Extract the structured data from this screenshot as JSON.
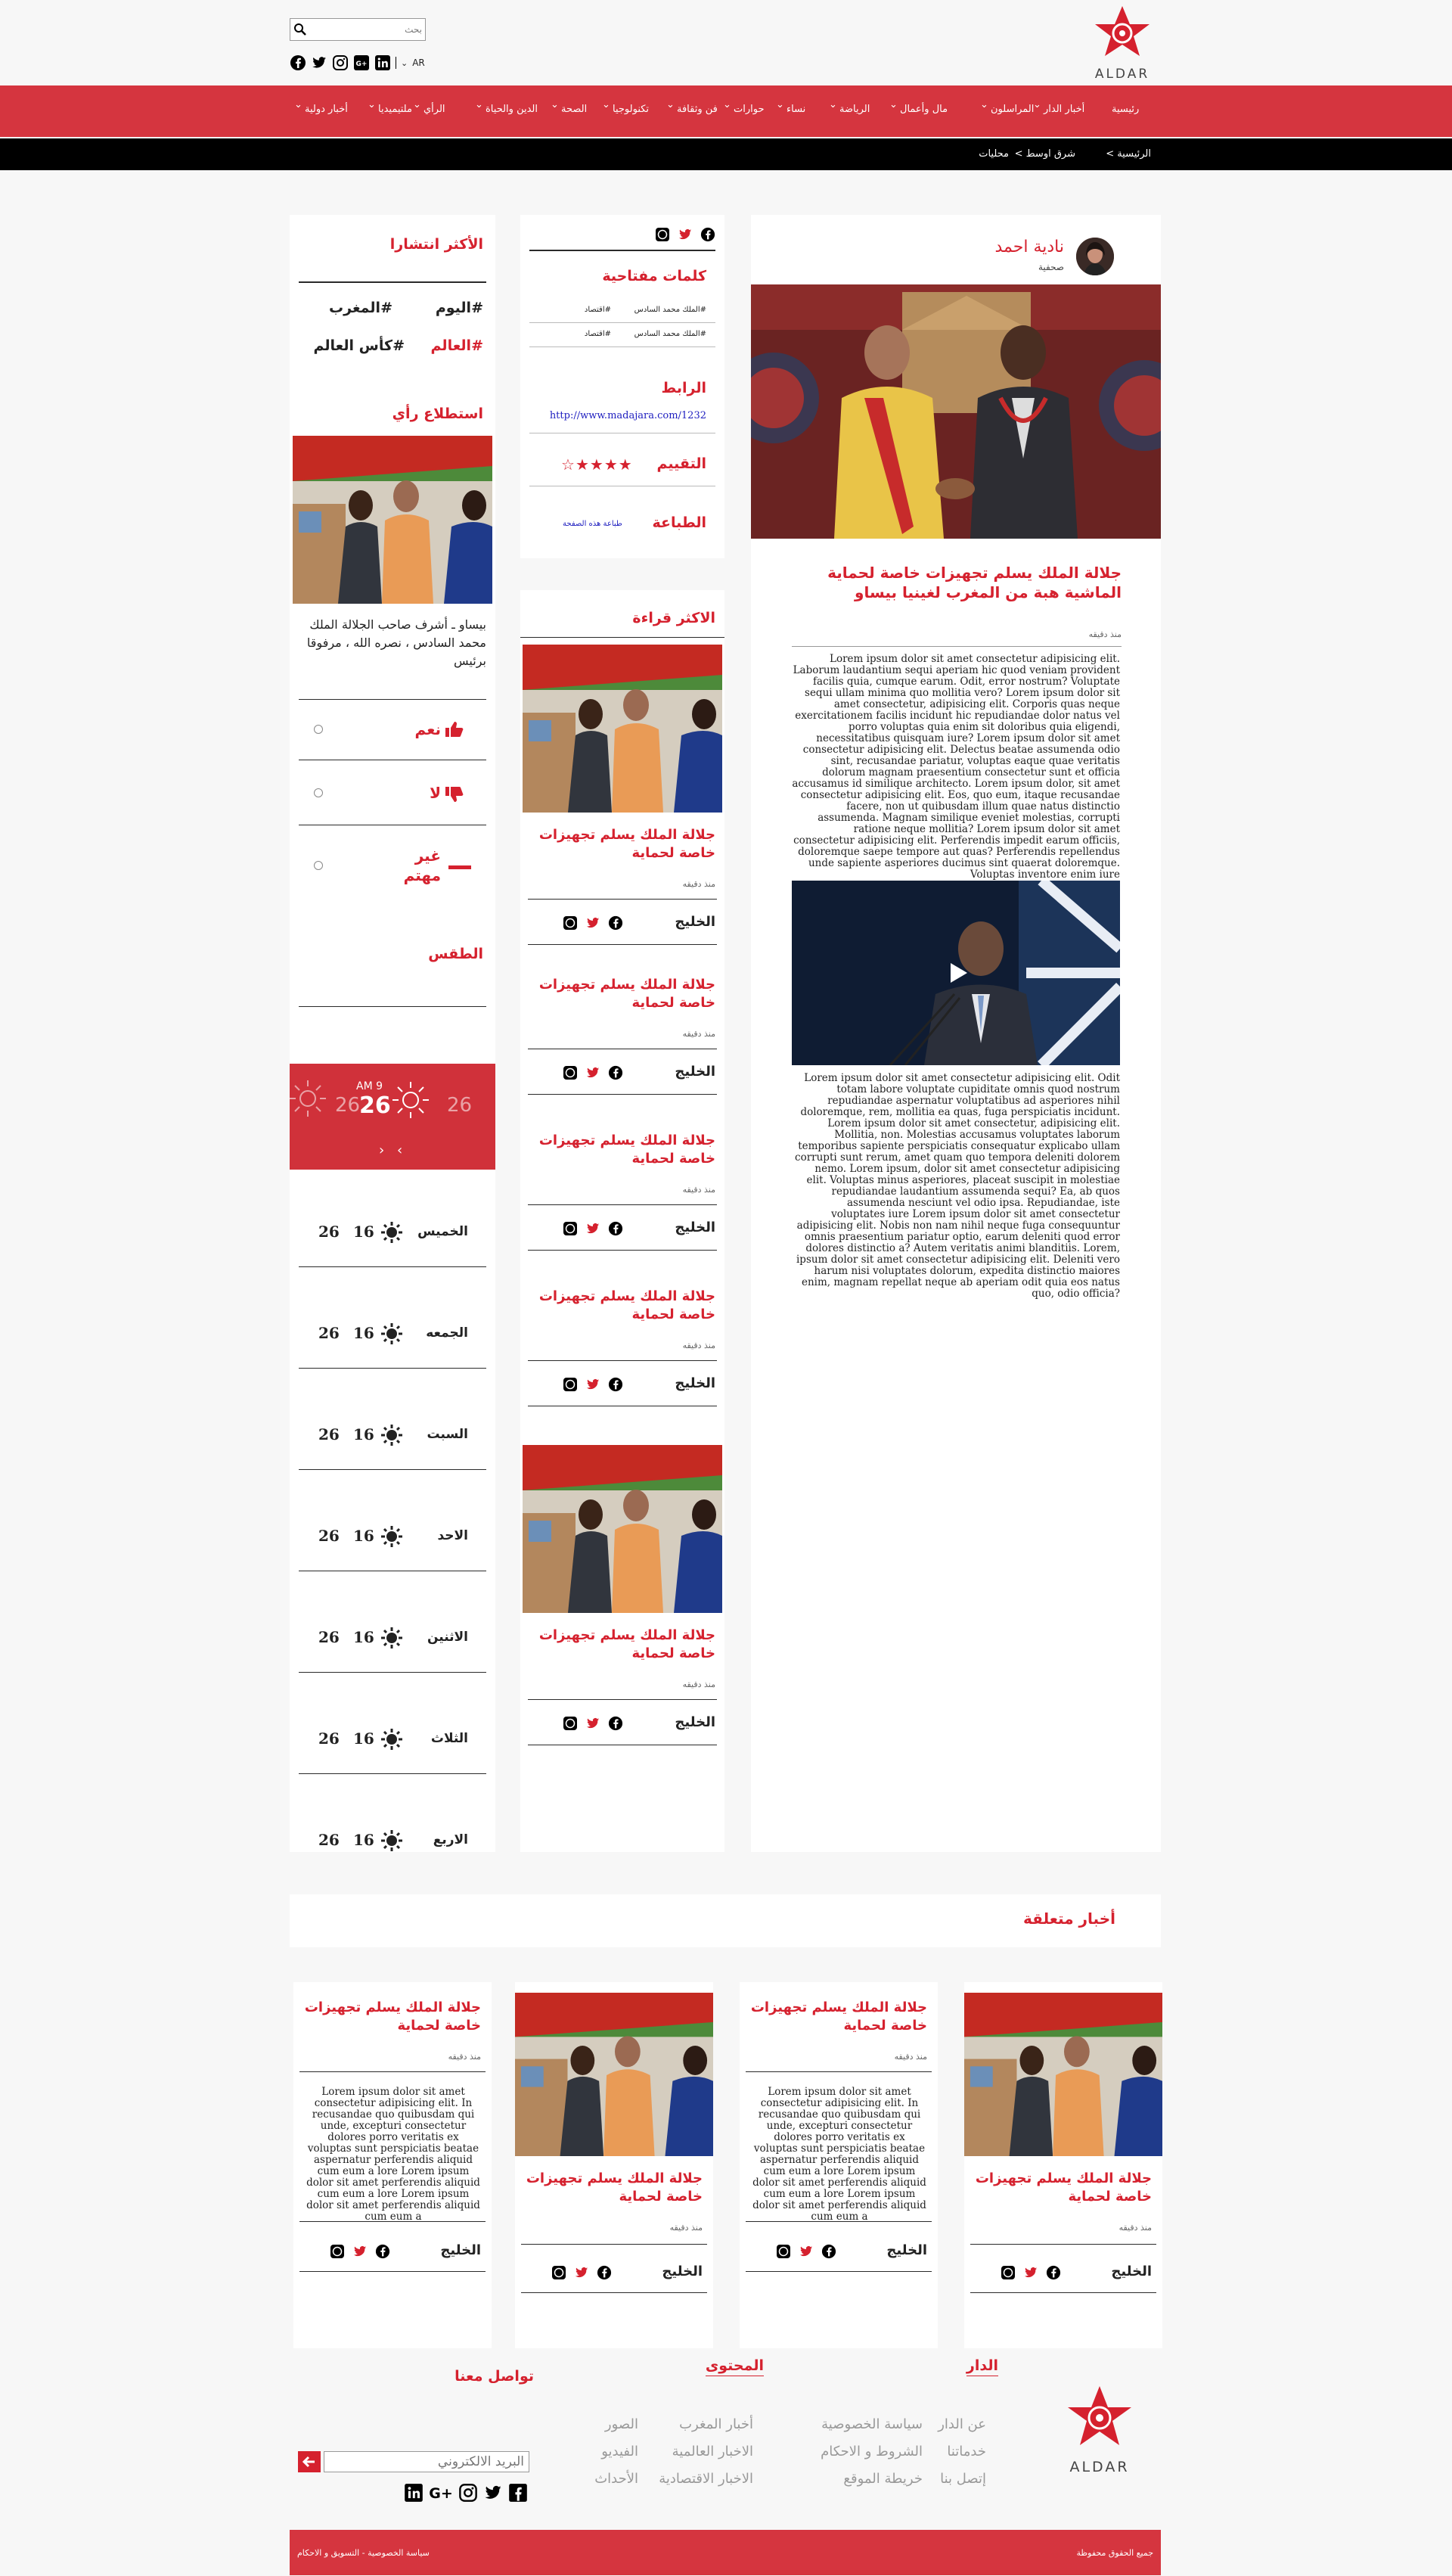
{
  "header": {
    "search_placeholder": "بحث",
    "lang": "AR",
    "logo_text": "ALDAR"
  },
  "nav": [
    "رئيسية",
    "أخبار الدار",
    "المراسلون",
    "مال وأعمال",
    "الرياضة",
    "نساء",
    "حوارات",
    "فن وثقافة",
    "تكنولوجيا",
    "الصحة",
    "الدين والحياة",
    "الرأي",
    "ملتيميديا",
    "أخبار دولية"
  ],
  "breadcrumb": [
    "الرئيسية >",
    "شرق اوسط >",
    "محليات"
  ],
  "article": {
    "author": "نادية احمد",
    "author_role": "صحفية",
    "title": "جلالة الملك يسلم تجهيزات خاصة لحماية الماشية هبة من المغرب لغينيا بيساو",
    "time": "منذ دقيقه",
    "body1": "Lorem ipsum dolor sit amet consectetur adipisicing elit. Laborum laudantium sequi aperiam hic quod veniam provident facilis quia, cumque earum. Odit, error nostrum? Voluptate sequi ullam minima quo mollitia vero? Lorem ipsum dolor sit amet consectetur, adipisicing elit. Corporis quas neque exercitationem facilis incidunt hic repudiandae dolor natus vel porro voluptas quia enim sit doloribus quia eligendi, necessitatibus quisquam iure? Lorem ipsum dolor sit amet consectetur adipisicing elit. Delectus beatae assumenda odio sint, recusandae pariatur, voluptas eaque quae veritatis dolorum magnam praesentium consectetur sunt et officia accusamus id similique architecto. Lorem ipsum dolor, sit amet consectetur adipisicing elit. Eos, quo eum, itaque recusandae facere, non ut quibusdam illum quae natus distinctio assumenda. Magnam similique eveniet molestias, corrupti ratione neque mollitia? Lorem ipsum dolor sit amet consectetur adipisicing elit. Perferendis impedit earum officiis, doloremque saepe tempore aut quas? Perferendis repellendus unde sapiente asperiores ducimus sint quaerat doloremque. Voluptas inventore enim iure",
    "body2": "Lorem ipsum dolor sit amet consectetur adipisicing elit. Odit totam labore voluptate cupiditate omnis quod nostrum repudiandae aspernatur voluptatibus ad asperiores nihil doloremque, rem, mollitia ea quas, fuga perspiciatis incidunt. Lorem ipsum dolor sit amet consectetur, adipisicing elit. Mollitia, non. Molestias accusamus voluptates laborum temporibus sapiente perspiciatis consequatur explicabo ullam corrupti sunt rerum, amet quam quo tempora deleniti dolorem nemo. Lorem ipsum, dolor sit amet consectetur adipisicing elit. Voluptas minus asperiores, placeat suscipit in molestiae repudiandae laudantium assumenda sequi? Ea, ab quos assumenda nesciunt vel odio ipsa. Repudiandae, iste voluptates iure Lorem ipsum dolor sit amet consectetur adipisicing elit. Nobis non nam nihil neque fuga consequuntur omnis praesentium pariatur optio, earum deleniti quod error dolores distinctio a? Autem veritatis animi blanditiis. Lorem, ipsum dolor sit amet consectetur adipisicing elit. Deleniti vero harum nisi voluptates dolorum, expedita distinctio maiores enim, magnam repellat neque ab aperiam odit quia eos natus quo, odio officia?"
  },
  "tools": {
    "keywords_title": "كلمات مفتاحية",
    "tags": [
      "#الملك محمد السادس",
      "#اقتصاد",
      "#الملك محمد السادس",
      "#اقتصاد"
    ],
    "link_title": "الرابط",
    "link_url": "http://www.madajara.com/1232",
    "rating_title": "التقييم",
    "rating": 4,
    "print_title": "الطباعة",
    "print_label": "طباعة هذه الصفحة"
  },
  "most_read": {
    "title": "الاكثر قراءة",
    "items": [
      {
        "title": "جلالة الملك يسلم تجهيزات خاصة لحماية",
        "time": "منذ دقيقه",
        "source": "الخليج"
      },
      {
        "title": "جلالة الملك يسلم تجهيزات خاصة لحماية",
        "time": "منذ دقيقه",
        "source": "الخليج"
      },
      {
        "title": "جلالة الملك يسلم تجهيزات خاصة لحماية",
        "time": "منذ دقيقه",
        "source": "الخليج"
      },
      {
        "title": "جلالة الملك يسلم تجهيزات خاصة لحماية",
        "time": "منذ دقيقه",
        "source": "الخليج"
      },
      {
        "title": "جلالة الملك يسلم تجهيزات خاصة لحماية",
        "time": "منذ دقيقه",
        "source": "الخليج"
      }
    ]
  },
  "trending": {
    "title": "الأكثر انتشارا",
    "tags": [
      "#اليوم",
      "#المغرب",
      "#العالم",
      "#كأس العالم"
    ]
  },
  "poll": {
    "title": "استطلاع رأي",
    "question": "بيساو ـ أشرف صاحب الجلالة الملك محمد السادس ، نصره الله ، مرفوقا برئيس",
    "options": [
      "نعم",
      "لا",
      "غير مهتم"
    ]
  },
  "weather": {
    "title": "الطقس",
    "slider": {
      "time": "9 AM",
      "temp": "26",
      "side_temp": "26"
    },
    "days": [
      {
        "day": "الخميس",
        "low": "16",
        "high": "26"
      },
      {
        "day": "الجمعه",
        "low": "16",
        "high": "26"
      },
      {
        "day": "السبت",
        "low": "16",
        "high": "26"
      },
      {
        "day": "الاحد",
        "low": "16",
        "high": "26"
      },
      {
        "day": "الاثنين",
        "low": "16",
        "high": "26"
      },
      {
        "day": "الثلاث",
        "low": "16",
        "high": "26"
      },
      {
        "day": "الاربع",
        "low": "16",
        "high": "26"
      }
    ]
  },
  "related": {
    "title": "أخبار متعلقة",
    "card_title": "جلالة الملك يسلم تجهيزات خاصة لحماية",
    "time": "منذ دقيقه",
    "source": "الخليج",
    "text": "Lorem ipsum dolor sit amet consectetur adipisicing elit. In recusandae quo quibusdam qui unde, excepturi consectetur dolores porro veritatis ex voluptas sunt perspiciatis beatae aspernatur perferendis aliquid cum eum a lore Lorem ipsum dolor sit amet perferendis aliquid cum eum a lore Lorem ipsum dolor sit amet perferendis aliquid cum eum a"
  },
  "footer": {
    "col1_title": "الدار",
    "col1_links": [
      "عن الدار",
      "سياسة الخصوصية",
      "خدماتنا",
      "الشروط و الاحكام",
      "إتصل بنا",
      "خريطة الموقع"
    ],
    "col2_title": "المحتوى",
    "col2_links": [
      "أخبار المغرب",
      "الصور",
      "الاخبار العالمية",
      "الفيديو",
      "الاخبار الاقتصادية",
      "الأحداث"
    ],
    "col3_title": "تواصل معنا",
    "email_placeholder": "البريد الالكتروني",
    "logo_text": "ALDAR",
    "copyright": "جميع الحقوق محفوظة",
    "policy": "سياسة الخصوصية - التسويق و الاحكام"
  },
  "colors": {
    "accent": "#d5212e",
    "nav": "#d5353f",
    "black": "#000000"
  }
}
